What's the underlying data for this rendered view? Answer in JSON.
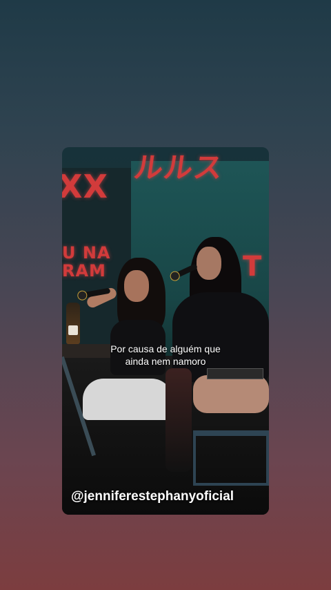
{
  "video": {
    "caption_line1": "Por causa de alguém que",
    "caption_line2": "ainda nem namoro",
    "watermark_handle": "@jenniferestephanyoficial"
  },
  "colors": {
    "background_top": "#1f3a47",
    "background_bottom": "#7c3d3f",
    "neon_accent": "#d23b3b",
    "caption_text": "#ffffff"
  }
}
